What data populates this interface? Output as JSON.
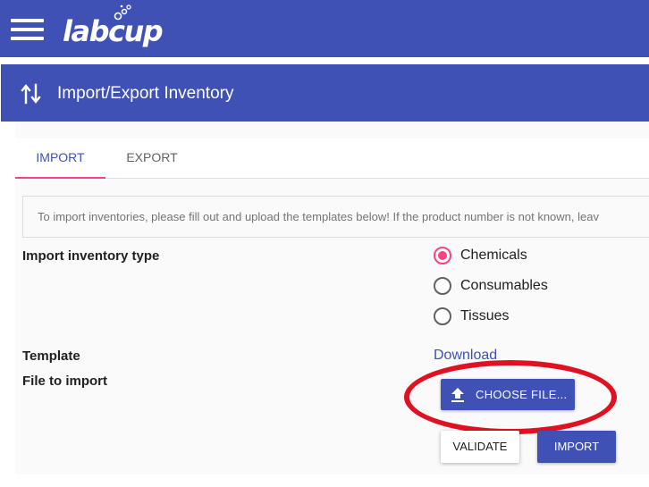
{
  "app": {
    "logo_text": "labcup",
    "brand_color": "#3f51b5",
    "accent_color": "#ff4081"
  },
  "header": {
    "title": "Import/Export Inventory",
    "icon": "swap-vertical-icon"
  },
  "tabs": [
    {
      "label": "IMPORT",
      "active": true
    },
    {
      "label": "EXPORT",
      "active": false
    }
  ],
  "info": {
    "text": "To import inventories, please fill out and upload the templates below! If the product number is not known, leav"
  },
  "form": {
    "type_label": "Import inventory type",
    "options": [
      {
        "label": "Chemicals",
        "checked": true
      },
      {
        "label": "Consumables",
        "checked": false
      },
      {
        "label": "Tissues",
        "checked": false
      }
    ],
    "template_label": "Template",
    "download_label": "Download",
    "file_label": "File to import",
    "choose_file_label": "CHOOSE FILE...",
    "choose_file_icon": "upload-icon"
  },
  "actions": {
    "validate_label": "VALIDATE",
    "import_label": "IMPORT"
  },
  "annotation": {
    "highlight_color": "#e01222"
  }
}
